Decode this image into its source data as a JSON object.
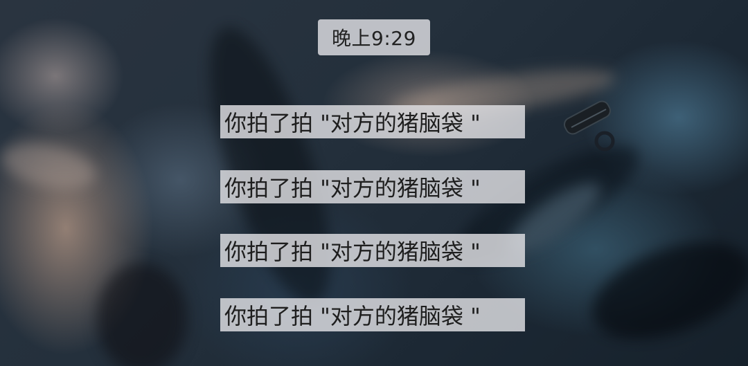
{
  "timestamp": "晚上9:29",
  "messages": [
    {
      "text": "你拍了拍 \"对方的猪脑袋 \""
    },
    {
      "text": "你拍了拍 \"对方的猪脑袋 \""
    },
    {
      "text": "你拍了拍 \"对方的猪脑袋 \""
    },
    {
      "text": "你拍了拍 \"对方的猪脑袋 \""
    }
  ],
  "colors": {
    "pill_background": "#e1e1e4",
    "text": "#1e1e1e",
    "wallpaper_dark": "#1e2630",
    "wallpaper_fabric_blue": "#375a6e"
  },
  "background": "chat-wallpaper-fabric-photo"
}
